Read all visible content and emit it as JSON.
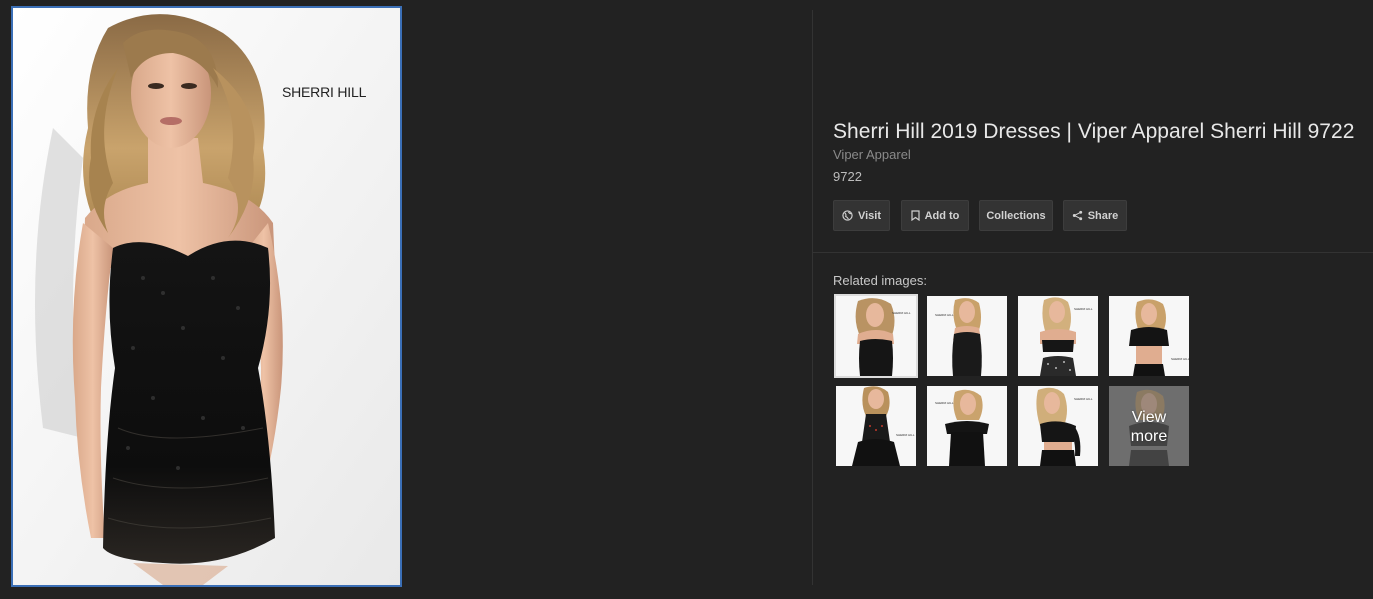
{
  "preview": {
    "brand_watermark": "SHERRI HILL",
    "alt": "Sherri Hill 9722 strapless beaded cocktail dress"
  },
  "info": {
    "title": "Sherri Hill 2019 Dresses | Viper Apparel Sherri Hill 9722",
    "source": "Viper Apparel",
    "description": "9722"
  },
  "actions": {
    "visit": "Visit",
    "add_to": "Add to",
    "collections": "Collections",
    "share": "Share"
  },
  "related": {
    "label": "Related images:",
    "view_more": "View\nmore",
    "thumbnails": [
      {
        "name": "related-thumb-1",
        "selected": true
      },
      {
        "name": "related-thumb-2",
        "selected": false
      },
      {
        "name": "related-thumb-3",
        "selected": false
      },
      {
        "name": "related-thumb-4",
        "selected": false
      },
      {
        "name": "related-thumb-5",
        "selected": false
      },
      {
        "name": "related-thumb-6",
        "selected": false
      },
      {
        "name": "related-thumb-7",
        "selected": false
      }
    ]
  },
  "colors": {
    "background": "#222222",
    "selection_border": "#3b6fb6",
    "button_bg": "#333333"
  },
  "icons": {
    "visit": "globe-icon",
    "add_to": "bookmark-icon",
    "share": "share-icon"
  }
}
